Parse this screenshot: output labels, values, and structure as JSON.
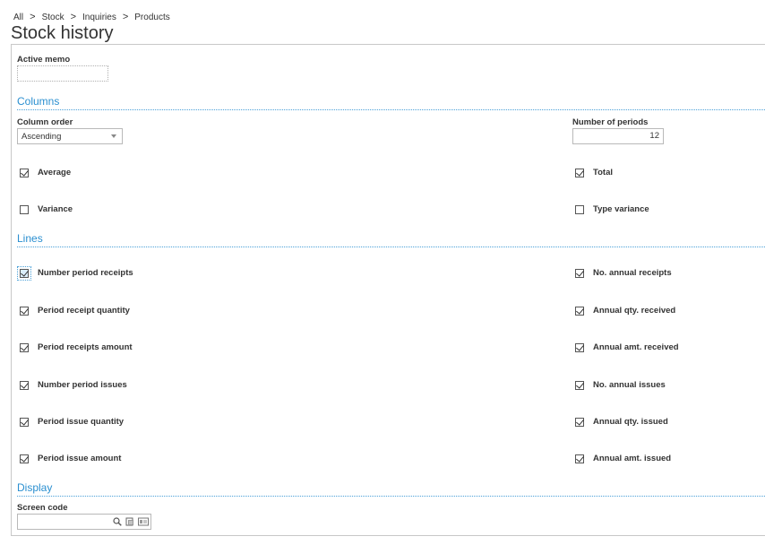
{
  "breadcrumb": [
    "All",
    "Stock",
    "Inquiries",
    "Products"
  ],
  "breadcrumb_sep": ">",
  "title": "Stock history",
  "active_memo": {
    "label": "Active memo",
    "value": ""
  },
  "sections": {
    "columns": "Columns",
    "lines": "Lines",
    "display": "Display"
  },
  "column_order": {
    "label": "Column order",
    "value": "Ascending"
  },
  "number_of_periods": {
    "label": "Number of periods",
    "value": "12"
  },
  "columns_checks": [
    {
      "label": "Average",
      "checked": true
    },
    {
      "label": "Total",
      "checked": true
    },
    {
      "label": "Variance",
      "checked": false
    },
    {
      "label": "Type variance",
      "checked": false
    }
  ],
  "lines_left": [
    {
      "label": "Number period receipts",
      "checked": true
    },
    {
      "label": "Period receipt quantity",
      "checked": true
    },
    {
      "label": "Period receipts amount",
      "checked": true
    },
    {
      "label": "Number period issues",
      "checked": true
    },
    {
      "label": "Period issue quantity",
      "checked": true
    },
    {
      "label": "Period issue amount",
      "checked": true
    }
  ],
  "lines_right": [
    {
      "label": "No. annual receipts",
      "checked": true
    },
    {
      "label": "Annual qty. received",
      "checked": true
    },
    {
      "label": "Annual amt. received",
      "checked": true
    },
    {
      "label": "No. annual issues",
      "checked": true
    },
    {
      "label": "Annual qty. issued",
      "checked": true
    },
    {
      "label": "Annual amt. issued",
      "checked": true
    }
  ],
  "screen_code": {
    "label": "Screen code",
    "value": ""
  },
  "icons": {
    "search": "search-icon",
    "select": "select-icon",
    "card": "card-icon"
  }
}
